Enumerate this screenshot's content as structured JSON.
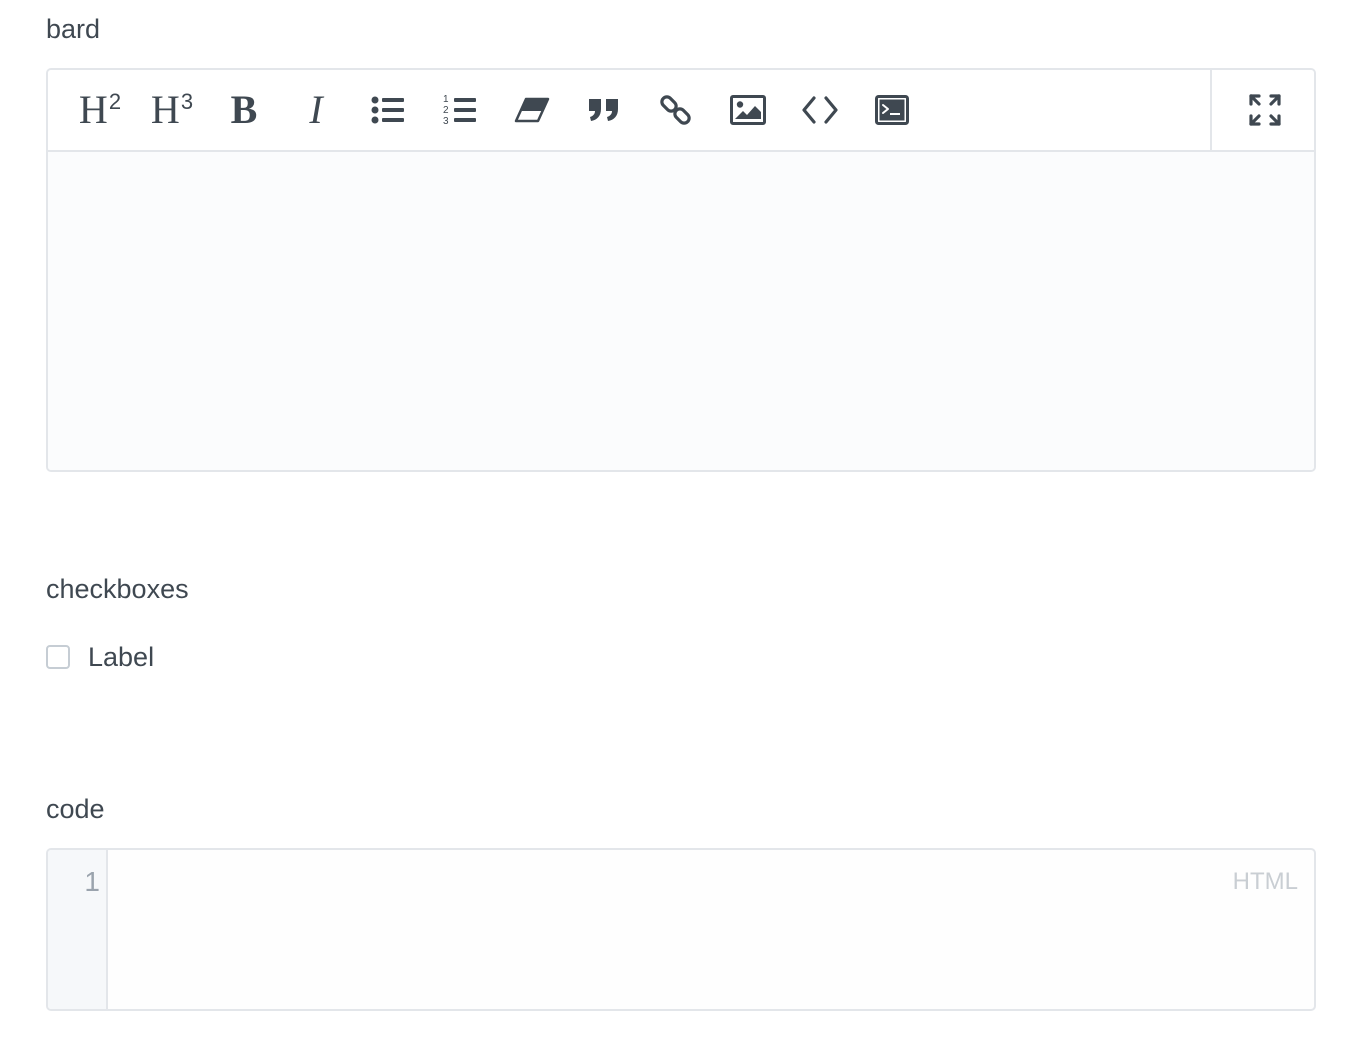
{
  "fields": {
    "bard": {
      "label": "bard",
      "toolbar": {
        "h2": {
          "letter": "H",
          "level": "2"
        },
        "h3": {
          "letter": "H",
          "level": "3"
        },
        "bold": "B",
        "italic": "I",
        "buttons": [
          "heading-2",
          "heading-3",
          "bold",
          "italic",
          "bullet-list",
          "ordered-list",
          "clear-formatting",
          "blockquote",
          "link",
          "image",
          "code",
          "code-block",
          "fullscreen"
        ]
      },
      "content": ""
    },
    "checkboxes": {
      "label": "checkboxes",
      "options": [
        {
          "label": "Label",
          "checked": false
        }
      ]
    },
    "code": {
      "label": "code",
      "line_numbers": [
        "1"
      ],
      "mode": "HTML",
      "content": ""
    }
  },
  "colors": {
    "text": "#3f4851",
    "border": "#e3e6ea",
    "editor_bg": "#fbfcfd",
    "gutter_bg": "#f6f8fa",
    "muted": "#c9ced3"
  },
  "icons": {
    "bullet_list": "list-ul-icon",
    "ordered_list": "list-ol-icon",
    "clear_formatting": "eraser-icon",
    "blockquote": "quote-icon",
    "link": "link-icon",
    "image": "image-icon",
    "code": "code-icon",
    "code_block": "terminal-icon",
    "fullscreen": "expand-icon"
  }
}
